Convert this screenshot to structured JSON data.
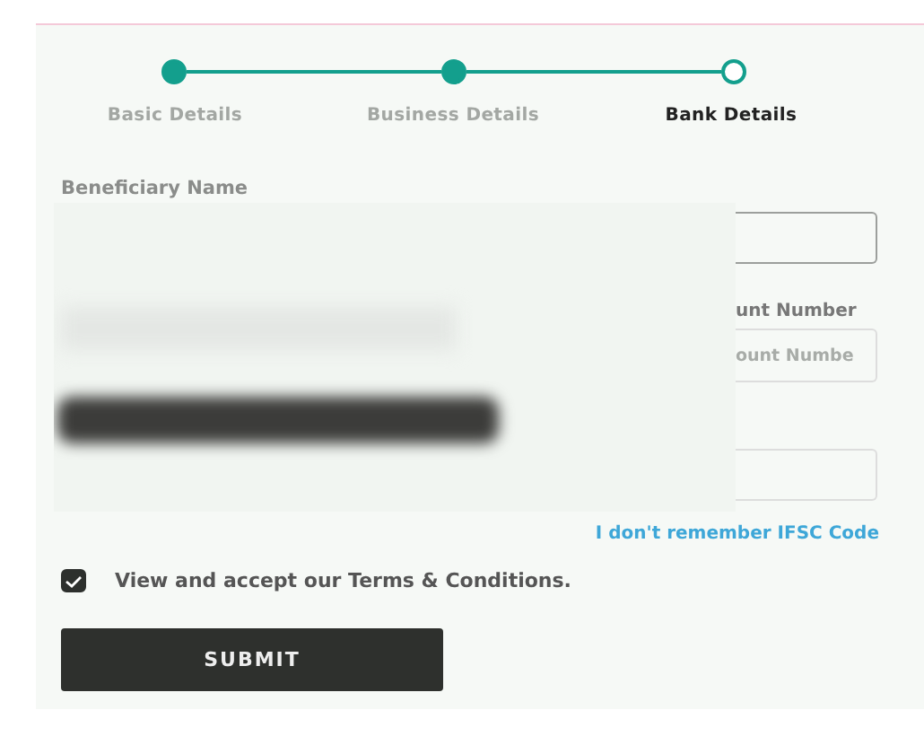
{
  "stepper": {
    "steps": [
      {
        "label": "Basic Details",
        "completed": true,
        "selected": false
      },
      {
        "label": "Business Details",
        "completed": true,
        "selected": false
      },
      {
        "label": "Bank Details",
        "completed": false,
        "selected": true
      }
    ]
  },
  "form": {
    "beneficiary_label": "Beneficiary Name",
    "account_label": "unt Number",
    "account_placeholder": "ount Numbe",
    "ifsc_link": "I don't remember IFSC Code",
    "terms": {
      "label": "View and accept our Terms & Conditions.",
      "checked": true
    },
    "submit": "SUBMIT"
  }
}
